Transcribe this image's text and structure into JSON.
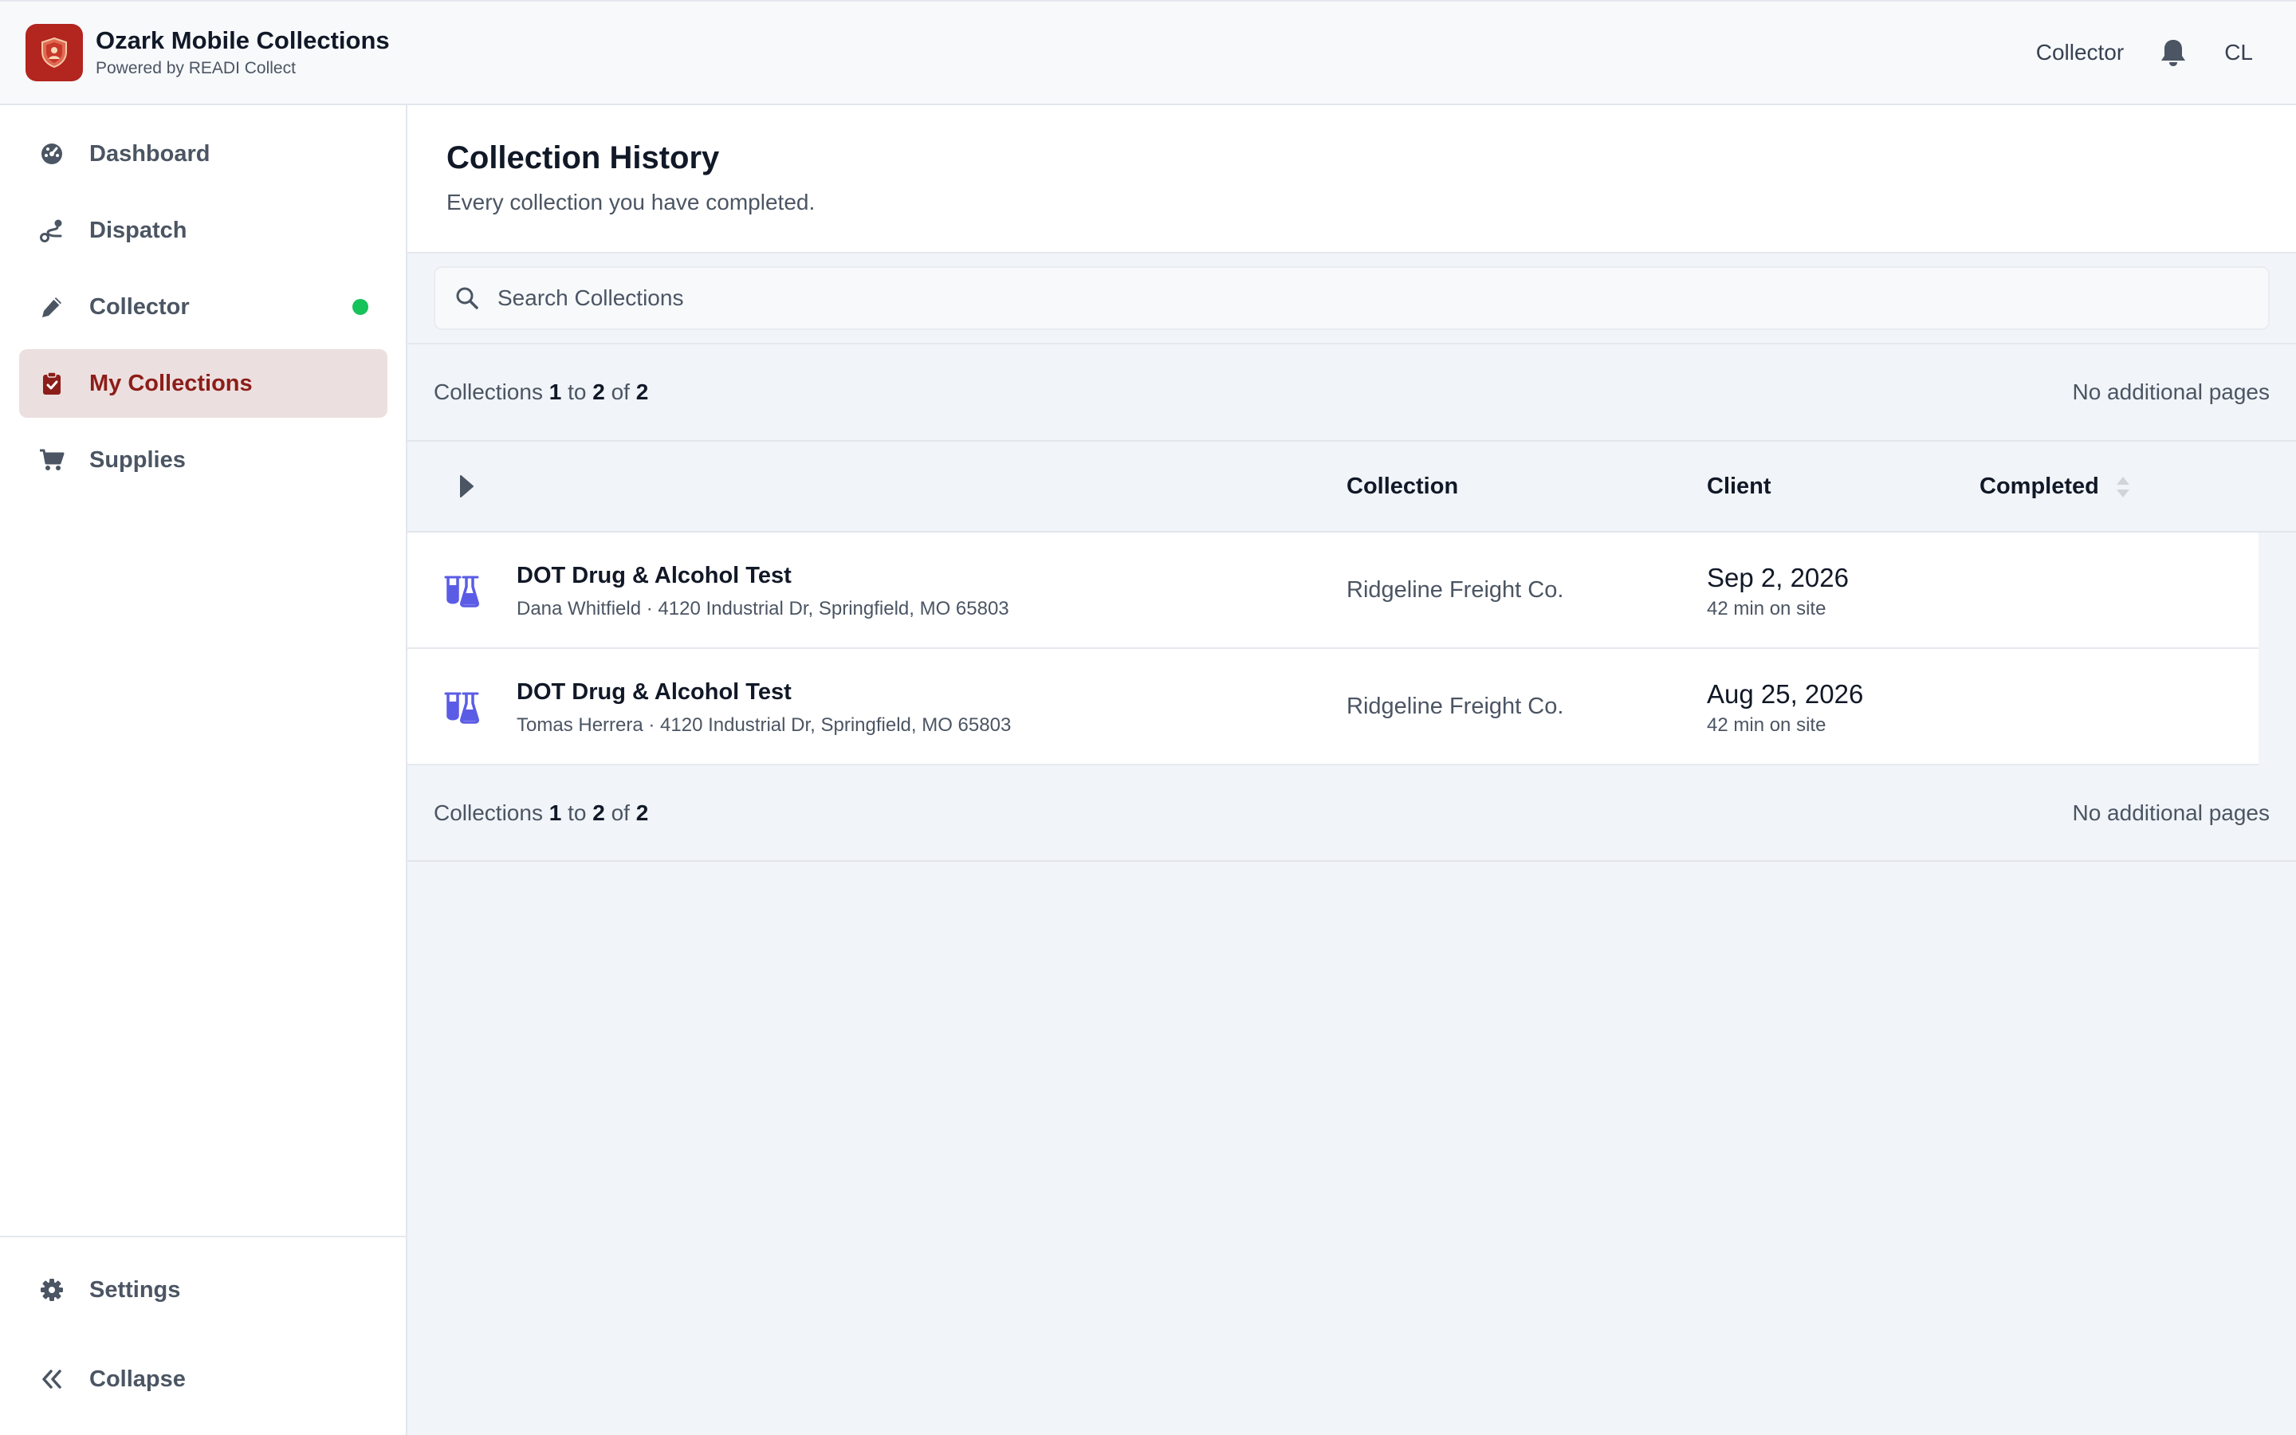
{
  "app": {
    "title": "Ozark Mobile Collections",
    "subtitle": "Powered by READI Collect",
    "brand_color": "#b3251f"
  },
  "topbar": {
    "role_label": "Collector",
    "bell_icon": "bell-icon",
    "user_initials": "CL"
  },
  "sidebar": {
    "items": [
      {
        "label": "Dashboard",
        "icon": "dashboard-gauge-icon",
        "active": false
      },
      {
        "label": "Dispatch",
        "icon": "route-icon",
        "active": false
      },
      {
        "label": "Collector",
        "icon": "pen-icon",
        "active": false,
        "status": "online",
        "status_color": "#16c25a"
      },
      {
        "label": "My Collections",
        "icon": "clipboard-check-icon",
        "active": true
      },
      {
        "label": "Supplies",
        "icon": "cart-icon",
        "active": false
      }
    ],
    "footer": [
      {
        "label": "Settings",
        "icon": "gear-icon"
      },
      {
        "label": "Collapse",
        "icon": "double-chevron-left-icon"
      }
    ]
  },
  "page": {
    "title": "Collection History",
    "subtitle": "Every collection you have completed."
  },
  "search": {
    "placeholder": "Search Collections",
    "value": ""
  },
  "pagination": {
    "prefix": "Collections",
    "from": "1",
    "to_word": "to",
    "to": "2",
    "of_word": "of",
    "total": "2",
    "pages_text": "No additional pages"
  },
  "table": {
    "columns": [
      "Collection",
      "Client",
      "Completed"
    ],
    "rows": [
      {
        "test": "DOT Drug & Alcohol Test",
        "details": "Dana Whitfield · 4120 Industrial Dr, Springfield, MO 65803",
        "client": "Ridgeline Freight Co.",
        "completed_date": "Sep 2, 2026",
        "duration": "42 min on site",
        "icon": "flask-test-icon"
      },
      {
        "test": "DOT Drug & Alcohol Test",
        "details": "Tomas Herrera · 4120 Industrial Dr, Springfield, MO 65803",
        "client": "Ridgeline Freight Co.",
        "completed_date": "Aug 25, 2026",
        "duration": "42 min on site",
        "icon": "flask-test-icon"
      }
    ]
  },
  "colors": {
    "active_nav_bg": "#ecdfdf",
    "active_nav_text": "#8c1d18",
    "test_icon": "#5b5ce6"
  }
}
